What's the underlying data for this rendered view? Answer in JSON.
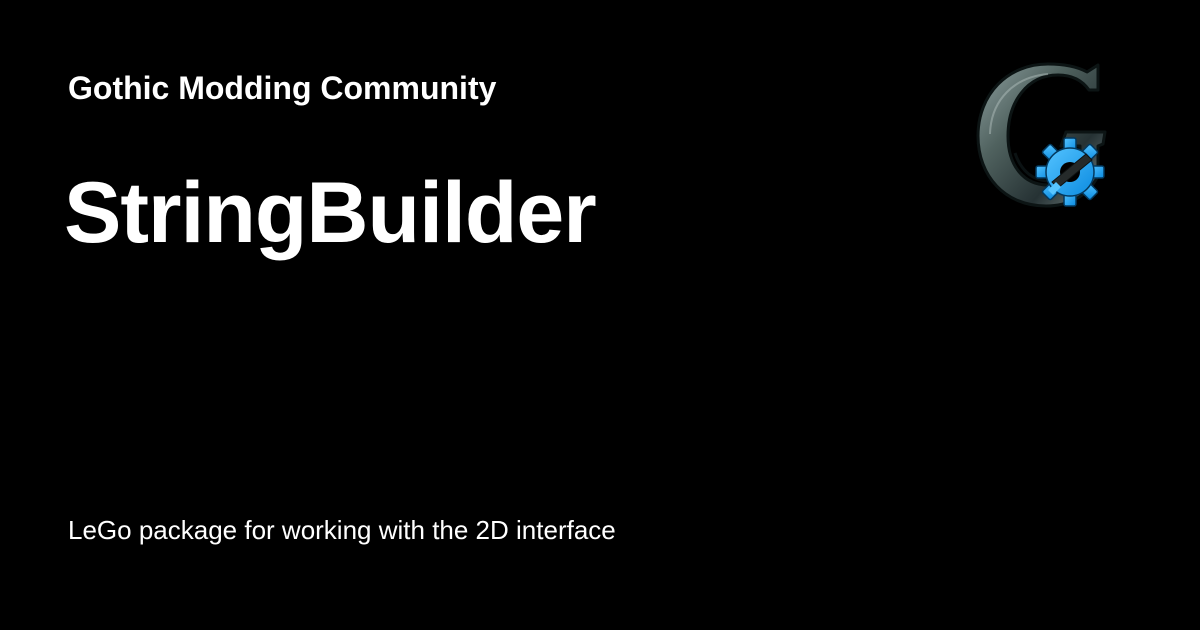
{
  "site": {
    "name": "Gothic Modding Community"
  },
  "page": {
    "title": "StringBuilder",
    "description": "LeGo package for working with the 2D interface"
  },
  "logo": {
    "icon": "gothic-g-gear-logo-icon",
    "colors": {
      "stone": "#5f6f70",
      "stone_dark": "#263234",
      "gear": "#1ea3ef"
    }
  }
}
